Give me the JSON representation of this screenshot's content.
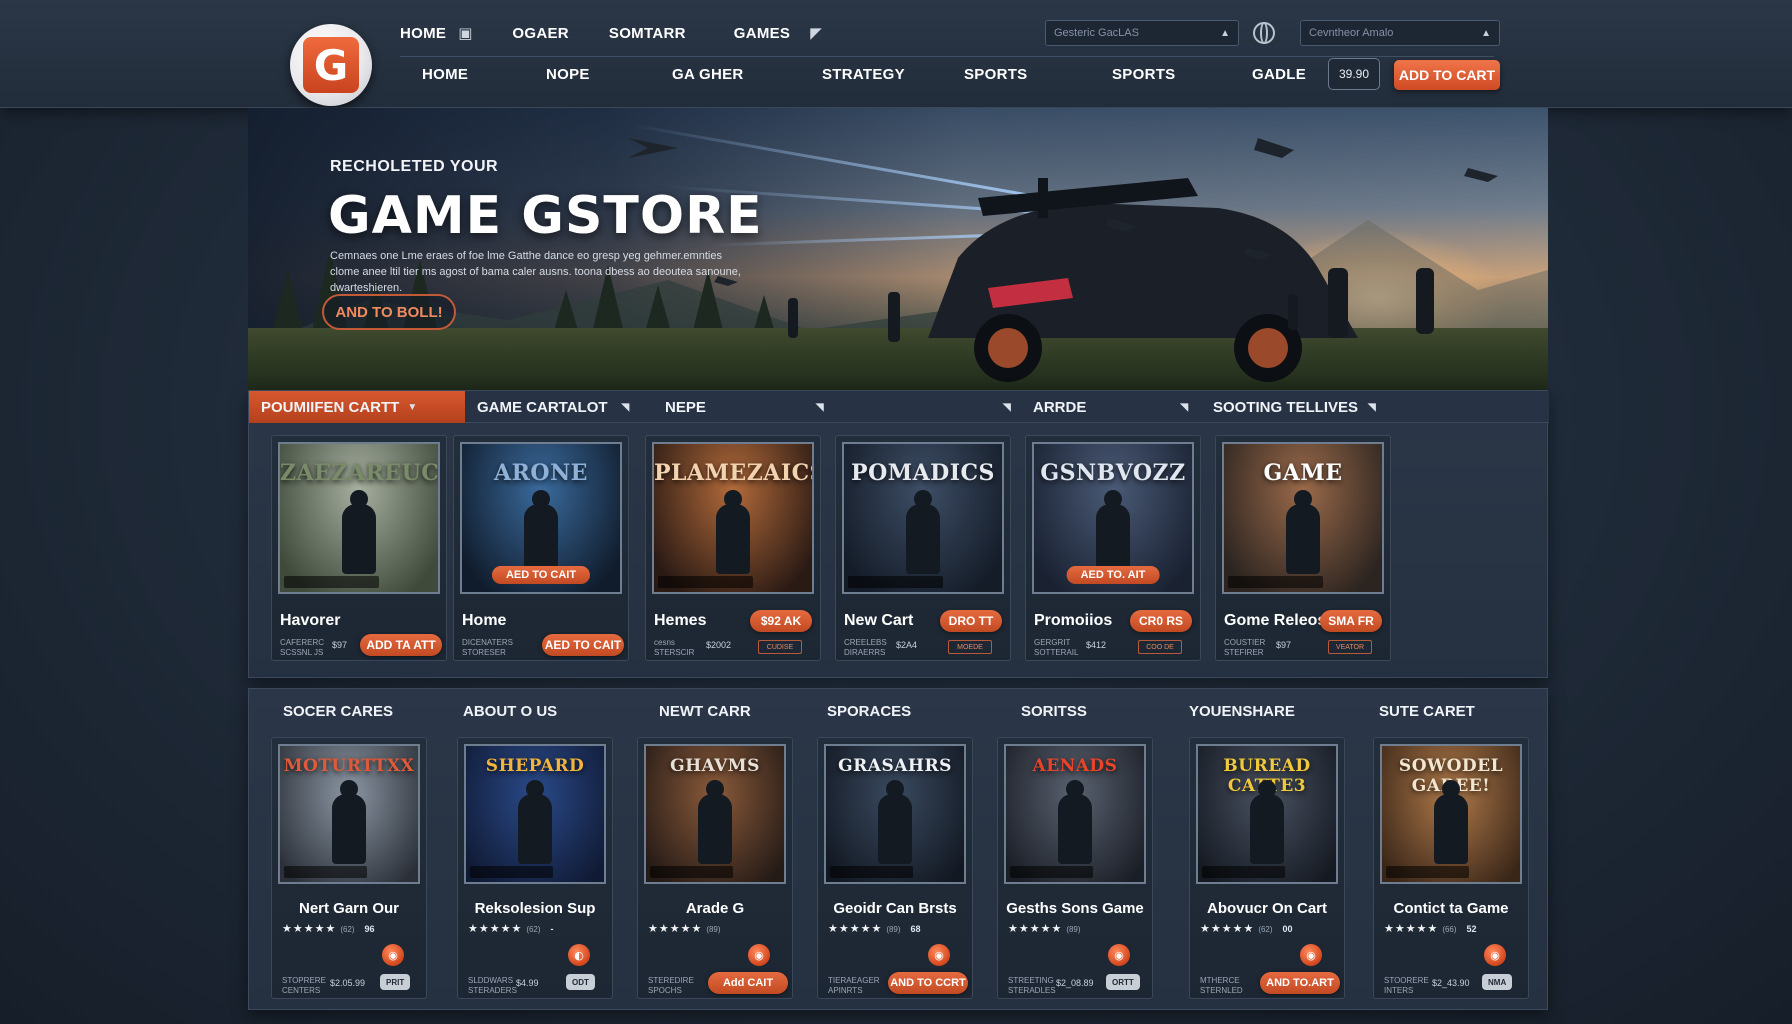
{
  "header": {
    "logo_letter": "G",
    "top_nav": [
      "HOME",
      "OGAER",
      "SOMTARR",
      "GAMES"
    ],
    "main_nav": [
      "HOME",
      "NOPE",
      "GA GHER",
      "STRATEGY",
      "SPORTS",
      "SPORTS",
      "GADLE"
    ],
    "search1_placeholder": "Gesteric GacLAS",
    "search2_placeholder": "Cevntheor Amalo",
    "price_pill": "39.90",
    "cart_button": "ADD TO CART"
  },
  "hero": {
    "subtitle": "RECHOLETED YOUR",
    "title": "GAME GSTORE",
    "description": "Cemnaes one Lme eraes of foe lme Gatthe dance eo gresp yeg gehmer.emnties clome anee ltil tier ms agost of bama caler ausns. toona dbess ao deoutea sanoune, dwarteshieren.",
    "button": "AND TO BOLL!"
  },
  "section1": {
    "tabs": [
      "POUMIIFEN CARTT",
      "GAME CARTALOT",
      "NEPE",
      "",
      "ARRDE",
      "SOOTING TELLIVES"
    ],
    "cards": [
      {
        "cover_title": "ZAEZAREUC",
        "title": "Havorer",
        "meta": "CAFERERC\nSCSSNL JS",
        "price": "$97",
        "button": "ADD TA ATT",
        "cover_button": "",
        "accent": "#7a8b6a",
        "tone1": "#a7b0a0",
        "tone2": "#3f4a3a"
      },
      {
        "cover_title": "ARONE",
        "title": "Home",
        "meta": "DICENATERS\nSTORESER",
        "price": "",
        "button": "AED TO CAIT",
        "cover_button": "AED TO CAIT",
        "accent": "#8fb1d8",
        "tone1": "#3a6a9c",
        "tone2": "#101c2c"
      },
      {
        "cover_title": "PLAMEZAICS",
        "title": "Hemes",
        "meta": "cesns\nSTERSCIR",
        "price": "$2002",
        "button": "$92 AK",
        "cover_button": "",
        "accent": "#f3d2b0",
        "tone1": "#b26a3a",
        "tone2": "#2a1a14",
        "ghost": "CUDISE"
      },
      {
        "cover_title": "POMADICS",
        "title": "New Cart",
        "meta": "CREELEBS\nDIRAERRS",
        "price": "$2A4",
        "button": "DRO TT",
        "cover_button": "",
        "accent": "#e6e9ee",
        "tone1": "#3e4e66",
        "tone2": "#141c28",
        "ghost": "MOEDE"
      },
      {
        "cover_title": "GSNBVOZZ",
        "title": "Promoiios",
        "meta": "GERGRIT\nSOTTERAIL",
        "price": "$412",
        "button": "CR0 RS",
        "cover_button": "AED TO. AIT",
        "accent": "#dfe6ef",
        "tone1": "#4a5a76",
        "tone2": "#1a2232",
        "ghost": "COO DE"
      },
      {
        "cover_title": "GAME",
        "title": "Gome Releos",
        "meta": "COUSTIER\nSTEFIRER",
        "price": "$97",
        "button": "SMA FR",
        "cover_button": "",
        "accent": "#ffffff",
        "tone1": "#9a6a4a",
        "tone2": "#2c2420",
        "ghost": "VEATOR"
      }
    ]
  },
  "section2": {
    "headings": [
      "SOCER CARES",
      "ABOUT O US",
      "NEWT CARR",
      "SPORACES",
      "SORITSS",
      "YOUENSHARE",
      "SUTE CARET"
    ],
    "cards": [
      {
        "cover_title": "MOTURTTXX",
        "title": "Nert Garn Our",
        "count": "(62)",
        "num": "96",
        "icon": "◉",
        "meta": "STOPRERE\nCENTERS",
        "price": "$2.05.99",
        "button": "PRIT",
        "button_type": "grey",
        "accent": "#e05a3a",
        "tone1": "#8b96a3",
        "tone2": "#2b3038"
      },
      {
        "cover_title": "SHEPARD",
        "title": "Reksolesion Sup",
        "count": "(62)",
        "num": "-",
        "icon": "◐",
        "meta": "SLDDWARS\nSTERADERS",
        "price": "$4.99",
        "button": "ODT",
        "button_type": "grey",
        "accent": "#f2b43c",
        "tone1": "#2a4a8a",
        "tone2": "#101a34"
      },
      {
        "cover_title": "GHAVMS",
        "title": "Arade G",
        "count": "(89)",
        "num": "",
        "icon": "◉",
        "meta": "STEREDIRE\nSPOCHS",
        "price": "",
        "button": "Add CAIT",
        "button_type": "orange",
        "accent": "#e7e0d6",
        "tone1": "#8a5a3a",
        "tone2": "#241a16"
      },
      {
        "cover_title": "GRASAHRS",
        "title": "Geoidr Can Brsts",
        "count": "(89)",
        "num": "68",
        "icon": "◉",
        "meta": "TIERAEAGER\nAPINRTS",
        "price": "",
        "button": "AND TO CCRT",
        "button_type": "orange",
        "accent": "#eef1f5",
        "tone1": "#3a4a60",
        "tone2": "#121822"
      },
      {
        "cover_title": "AENADS",
        "title": "Gesths Sons Game",
        "count": "(89)",
        "num": "",
        "icon": "◉",
        "meta": "STREETING\nSTERADLES",
        "price": "$2_08.89",
        "button": "ORTT",
        "button_type": "grey",
        "accent": "#e8442a",
        "tone1": "#5a6270",
        "tone2": "#1a1e26"
      },
      {
        "cover_title": "BUREAD CATTE3",
        "title": "Abovucr On Cart",
        "count": "(62)",
        "num": "00",
        "icon": "◉",
        "meta": "MTHERCE\nSTERNLED",
        "price": "",
        "button": "AND TO.ART",
        "button_type": "orange",
        "accent": "#f0c83a",
        "tone1": "#4a5262",
        "tone2": "#151a22"
      },
      {
        "cover_title": "SOWODEL GABEE!",
        "title": "Contict ta Game",
        "count": "(66)",
        "num": "52",
        "icon": "◉",
        "meta": "STOORERE\nINTERS",
        "price": "$2_43.90",
        "button": "NMA",
        "button_type": "grey",
        "accent": "#f3e6d0",
        "tone1": "#b07a4a",
        "tone2": "#3a2618"
      }
    ]
  }
}
